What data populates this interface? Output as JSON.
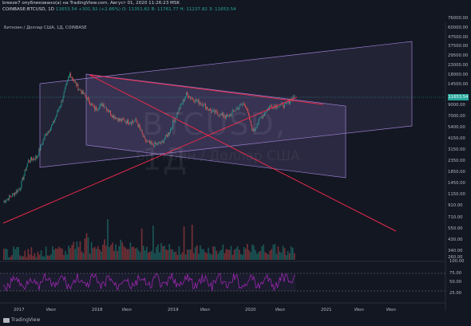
{
  "header": {
    "line1": "breeze7 опубликовано(a) на TradingView.com, Август 01, 2020 11:26:23 MSK",
    "symbol": "COINBASE:BTCUSD, 1D",
    "last": "11653.54",
    "change": "+301.92 (+2.66%)",
    "o": "О: 11351.62",
    "h": "В: 11761.77",
    "l": "Н: 11237.82",
    "c": "З: 11653.54"
  },
  "symbol_label": "Биткоин / Доллар США, 1Д, COINBASE",
  "watermark": {
    "ticker": "BTCUSD, 1Д",
    "name": "Биткоин / Доллар США"
  },
  "price_tag": "11653.54",
  "branding": "TradingView",
  "colors": {
    "background": "#131722",
    "up": "#26a69a",
    "down": "#ef5350",
    "trend": "#e8294a",
    "channel": "#9c7fd1",
    "rsi": "#9c27b0"
  },
  "chart_data": {
    "type": "line",
    "yscale": "log",
    "price_axis_ticks": [
      "76000.00",
      "60000.00",
      "47500.00",
      "37500.00",
      "29500.00",
      "23000.00",
      "18000.00",
      "14500.00",
      "11653.54",
      "9000.00",
      "7000.00",
      "5400.00",
      "4150.00",
      "3150.00",
      "2350.00",
      "1850.00",
      "1450.00",
      "1150.00",
      "910.00",
      "710.00",
      "550.00",
      "430.00",
      "340.00",
      "260.00"
    ],
    "rsi_axis_ticks": [
      "100.00",
      "75.00",
      "50.00",
      "25.00"
    ],
    "x_tick_labels": [
      "2017",
      "Июл",
      "2018",
      "Июл",
      "2019",
      "Июл",
      "2020",
      "Июл",
      "2021",
      "Июл",
      "Июл"
    ],
    "series": [
      {
        "values": [
          950,
          1100,
          1300,
          2500,
          2700,
          4500,
          6000,
          10000,
          19500,
          14000,
          11000,
          8500,
          9500,
          7500,
          6500,
          6300,
          6400,
          4000,
          3600,
          3800,
          5000,
          8000,
          12000,
          10500,
          9500,
          8000,
          7500,
          7000,
          8500,
          9800,
          5000,
          7000,
          9000,
          9200,
          9300,
          11653.54
        ]
      }
    ]
  }
}
